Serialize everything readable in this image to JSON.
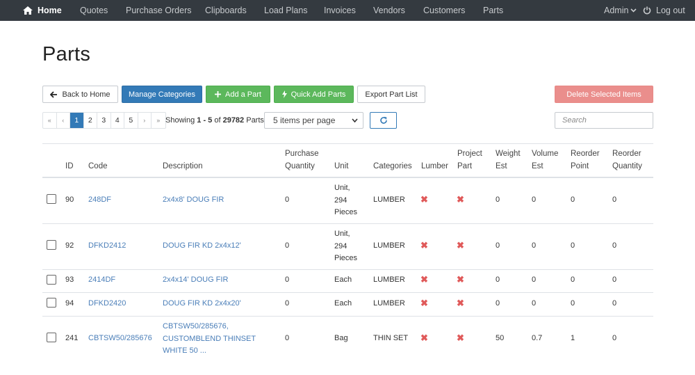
{
  "nav": {
    "home": "Home",
    "items": [
      "Quotes",
      "Purchase Orders",
      "Clipboards",
      "Load Plans",
      "Invoices",
      "Vendors",
      "Customers",
      "Parts"
    ],
    "admin": "Admin",
    "logout": "Log out"
  },
  "page": {
    "title": "Parts"
  },
  "toolbar": {
    "back": "Back to Home",
    "manage": "Manage Categories",
    "add": "Add a Part",
    "quick_add": "Quick Add Parts",
    "export": "Export Part List",
    "delete": "Delete Selected Items"
  },
  "pagination": {
    "first": "«",
    "prev": "‹",
    "pages": [
      "1",
      "2",
      "3",
      "4",
      "5"
    ],
    "current": "1",
    "next": "›",
    "last": "»",
    "showing_prefix": "Showing ",
    "range": "1 - 5",
    "of": " of ",
    "total": "29782",
    "suffix": " Parts"
  },
  "per_page": {
    "selected": "5 items per page"
  },
  "search": {
    "placeholder": "Search"
  },
  "table": {
    "headers": {
      "id": "ID",
      "code": "Code",
      "description": "Description",
      "purchase_qty": [
        "Purchase",
        "Quantity"
      ],
      "unit": "Unit",
      "categories": "Categories",
      "lumber": "Lumber",
      "project_part": [
        "Project",
        "Part"
      ],
      "weight_est": [
        "Weight",
        "Est"
      ],
      "volume_est": [
        "Volume",
        "Est"
      ],
      "reorder_point": [
        "Reorder",
        "Point"
      ],
      "reorder_qty": [
        "Reorder",
        "Quantity"
      ]
    },
    "rows": [
      {
        "id": "90",
        "code": "248DF",
        "description": [
          "2x4x8' DOUG FIR"
        ],
        "purchase_qty": "0",
        "unit": [
          "Unit,",
          "294",
          "Pieces"
        ],
        "categories": "LUMBER",
        "lumber": "✖",
        "project_part": "✖",
        "weight_est": "0",
        "volume_est": "0",
        "reorder_point": "0",
        "reorder_qty": "0"
      },
      {
        "id": "92",
        "code": "DFKD2412",
        "description": [
          "DOUG FIR KD 2x4x12'"
        ],
        "purchase_qty": "0",
        "unit": [
          "Unit,",
          "294",
          "Pieces"
        ],
        "categories": "LUMBER",
        "lumber": "✖",
        "project_part": "✖",
        "weight_est": "0",
        "volume_est": "0",
        "reorder_point": "0",
        "reorder_qty": "0"
      },
      {
        "id": "93",
        "code": "2414DF",
        "description": [
          "2x4x14' DOUG FIR"
        ],
        "purchase_qty": "0",
        "unit": [
          "Each"
        ],
        "categories": "LUMBER",
        "lumber": "✖",
        "project_part": "✖",
        "weight_est": "0",
        "volume_est": "0",
        "reorder_point": "0",
        "reorder_qty": "0"
      },
      {
        "id": "94",
        "code": "DFKD2420",
        "description": [
          "DOUG FIR KD 2x4x20'"
        ],
        "purchase_qty": "0",
        "unit": [
          "Each"
        ],
        "categories": "LUMBER",
        "lumber": "✖",
        "project_part": "✖",
        "weight_est": "0",
        "volume_est": "0",
        "reorder_point": "0",
        "reorder_qty": "0"
      },
      {
        "id": "241",
        "code": "CBTSW50/285676",
        "description": [
          "CBTSW50/285676,",
          "CUSTOMBLEND THINSET",
          "WHITE 50 ..."
        ],
        "purchase_qty": "0",
        "unit": [
          "Bag"
        ],
        "categories": "THIN SET",
        "lumber": "✖",
        "project_part": "✖",
        "weight_est": "50",
        "volume_est": "0.7",
        "reorder_point": "1",
        "reorder_qty": "0"
      }
    ]
  }
}
